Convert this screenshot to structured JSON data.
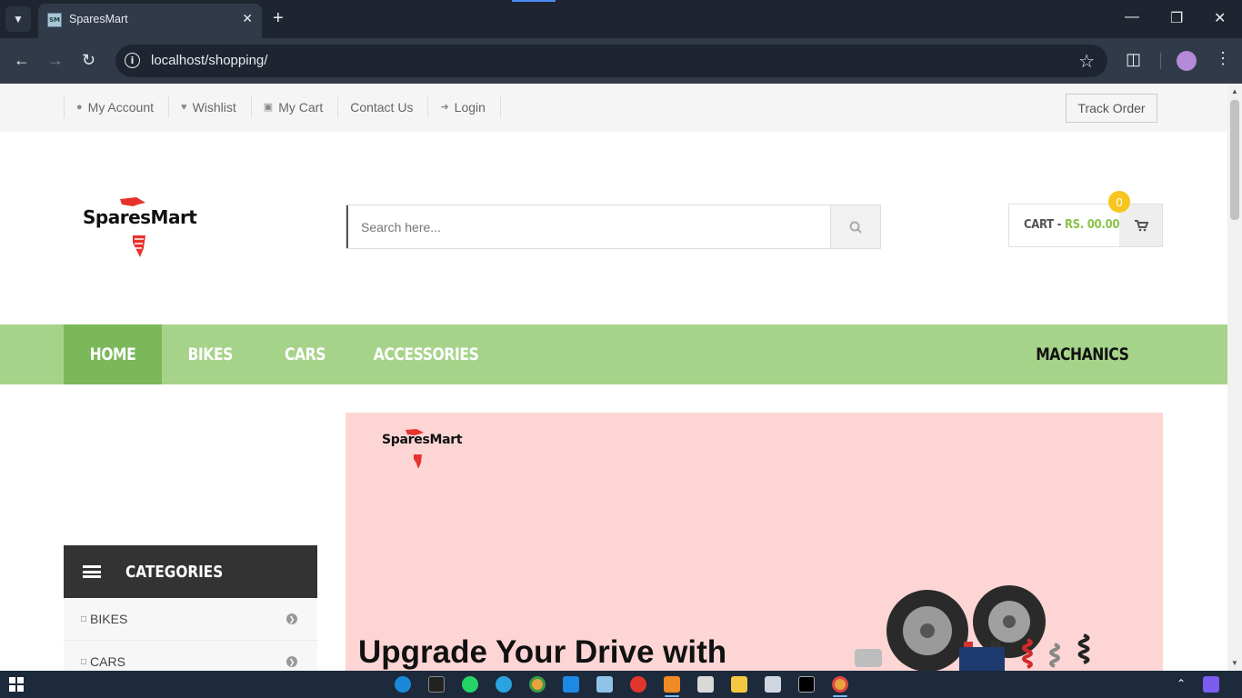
{
  "browser": {
    "tab_title": "SparesMart",
    "favicon_text": "SM",
    "url": "localhost/shopping/"
  },
  "topbar": {
    "links": [
      {
        "label": "My Account",
        "icon": "user-icon"
      },
      {
        "label": "Wishlist",
        "icon": "heart-icon"
      },
      {
        "label": "My Cart",
        "icon": "cart-icon"
      },
      {
        "label": "Contact Us",
        "icon": ""
      },
      {
        "label": "Login",
        "icon": "sign-in-icon"
      }
    ],
    "track_order": "Track Order"
  },
  "logo": {
    "text": "SparesMart"
  },
  "search": {
    "placeholder": "Search here..."
  },
  "cart": {
    "label": "CART -",
    "amount": "RS. 00.00",
    "count": "0"
  },
  "nav": {
    "items": [
      "HOME",
      "BIKES",
      "CARS",
      "ACCESSORIES"
    ],
    "right_item": "MACHANICS",
    "active": "HOME"
  },
  "categories": {
    "title": "CATEGORIES",
    "items": [
      "BIKES",
      "CARS"
    ]
  },
  "banner": {
    "logo_text": "SparesMart",
    "heading": "Upgrade Your Drive with"
  },
  "colors": {
    "nav_green": "#a6d38a",
    "nav_active": "#7ab85a",
    "banner_pink": "#fdd5d5",
    "accent_yellow": "#f7c520",
    "price_green": "#8bc34a"
  }
}
